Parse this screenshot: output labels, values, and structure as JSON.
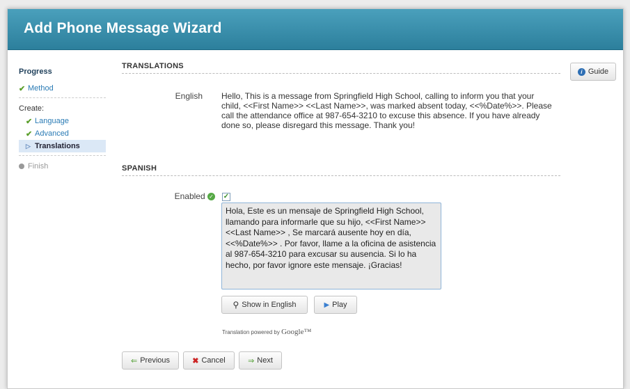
{
  "window": {
    "title": "Add Phone Message Wizard"
  },
  "sidebar": {
    "progress_heading": "Progress",
    "method": "Method",
    "create_label": "Create:",
    "language": "Language",
    "advanced": "Advanced",
    "translations": "Translations",
    "finish": "Finish"
  },
  "guide_button": {
    "label": "Guide",
    "icon": "info-icon"
  },
  "translations_section": {
    "heading": "TRANSLATIONS",
    "english_label": "English",
    "english_text": "Hello, This is a message from Springfield High School, calling to inform you that your child, <<First Name>> <<Last Name>>, was marked absent today, <<%Date%>>. Please call the attendance office at 987-654-3210 to excuse this absence. If you have already done so, please disregard this message. Thank you!"
  },
  "spanish_section": {
    "heading": "SPANISH",
    "enabled_label": "Enabled",
    "enabled_checked": true,
    "spanish_text": "Hola, Este es un mensaje de Springfield High School, llamando para informarle que su hijo, <<First Name>><<Last Name>> , Se marcará ausente hoy en día, <<%Date%>> . Por favor, llame a la oficina de asistencia al 987-654-3210 para excusar su ausencia. Si lo ha hecho, por favor ignore este mensaje. ¡Gracias!",
    "show_in_english_label": "Show in English",
    "play_label": "Play",
    "powered_by_text": "Translation powered by",
    "powered_by_brand": "Google™"
  },
  "footer": {
    "previous_label": "Previous",
    "cancel_label": "Cancel",
    "next_label": "Next"
  },
  "colors": {
    "title_bar": "#3a8fae",
    "check_green": "#5a9e2a",
    "link_blue": "#2a7bb5",
    "cancel_red": "#cc2222"
  }
}
